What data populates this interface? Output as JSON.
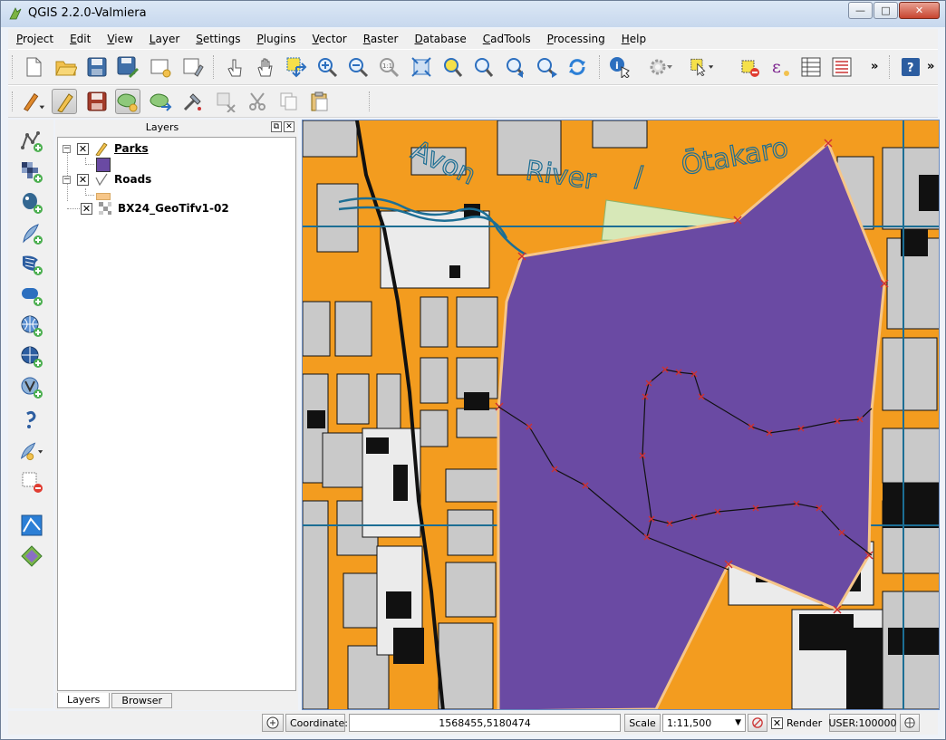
{
  "window": {
    "title": "QGIS 2.2.0-Valmiera",
    "minimize": "—",
    "maximize": "□",
    "close": "✕"
  },
  "menu": [
    "Project",
    "Edit",
    "View",
    "Layer",
    "Settings",
    "Plugins",
    "Vector",
    "Raster",
    "Database",
    "CadTools",
    "Processing",
    "Help"
  ],
  "toolbar1_icons": [
    "new-project-icon",
    "open-project-icon",
    "save-project-icon",
    "save-as-icon",
    "new-print-composer-icon",
    "composer-manager-icon",
    "touch-zoom-icon",
    "pan-icon",
    "pan-to-selection-icon",
    "zoom-in-icon",
    "zoom-out-icon",
    "zoom-actual-icon",
    "zoom-full-icon",
    "zoom-to-selection-icon",
    "zoom-to-layer-icon",
    "zoom-last-icon",
    "zoom-next-icon",
    "refresh-icon",
    "identify-icon",
    "run-action-icon",
    "select-features-icon",
    "deselect-icon",
    "field-calculator-icon",
    "attribute-table-icon",
    "statistics-icon",
    "help-icon"
  ],
  "toolbar2_icons": [
    "current-edits-icon",
    "toggle-editing-icon",
    "save-edits-icon",
    "add-feature-icon",
    "move-feature-icon",
    "node-tool-icon",
    "delete-selected-icon",
    "cut-features-icon",
    "copy-features-icon",
    "paste-features-icon"
  ],
  "left_toolbar_icons": [
    "add-vector-layer-icon",
    "add-raster-layer-icon",
    "add-postgis-layer-icon",
    "add-spatialite-layer-icon",
    "add-mssql-layer-icon",
    "add-oracle-layer-icon",
    "add-wms-layer-icon",
    "add-wcs-layer-icon",
    "add-wfs-layer-icon",
    "add-delimited-text-icon",
    "new-shapefile-icon",
    "remove-layer-icon",
    "georeferencer-icon",
    "gps-tools-icon"
  ],
  "layers_panel": {
    "title": "Layers",
    "layers": [
      {
        "name": "Parks",
        "checked": "✕",
        "legend_color": "#6a4aa3"
      },
      {
        "name": "Roads",
        "checked": "✕",
        "legend_color": "#f6c689"
      },
      {
        "name": "BX24_GeoTifv1-02",
        "checked": "✕"
      }
    ],
    "tabs": [
      "Layers",
      "Browser"
    ]
  },
  "map": {
    "labels": [
      "Avon",
      "River",
      "/",
      "Ōtakaro"
    ],
    "colors": {
      "parks": "#6a4aa3",
      "roads": "#f39c1f",
      "blocks": "#c9c9c9",
      "water": "#1c6e94",
      "grid": "#1c6e94"
    }
  },
  "statusbar": {
    "coordinate_label": "Coordinate:",
    "coordinate_value": "1568455,5180474",
    "scale_label": "Scale",
    "scale_value": "1:11,500",
    "render_label": "Render",
    "render_checked": "✕",
    "crs": "USER:100000"
  }
}
